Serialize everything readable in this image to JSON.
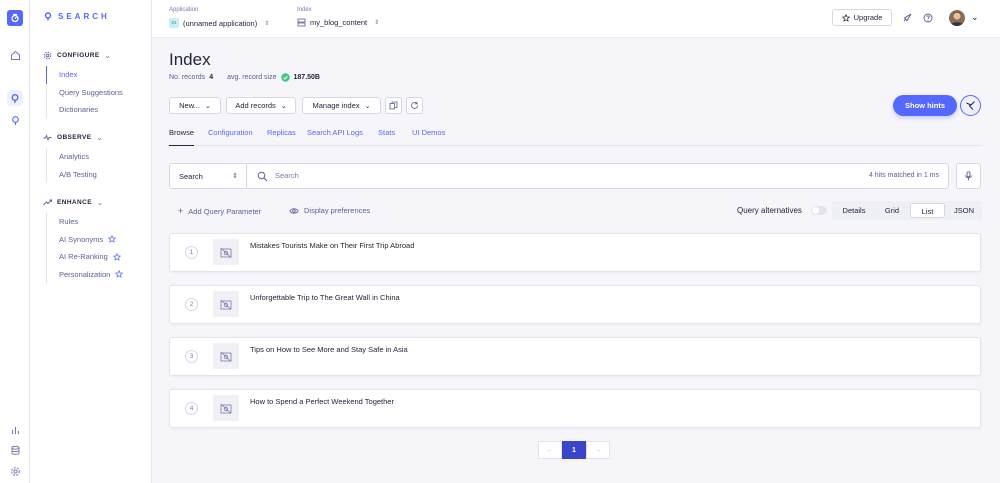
{
  "brand": {
    "name": "SEARCH"
  },
  "sidebar": {
    "sections": [
      {
        "title": "CONFIGURE",
        "items": [
          {
            "label": "Index",
            "active": true
          },
          {
            "label": "Query Suggestions"
          },
          {
            "label": "Dictionaries"
          }
        ]
      },
      {
        "title": "OBSERVE",
        "items": [
          {
            "label": "Analytics"
          },
          {
            "label": "A/B Testing"
          }
        ]
      },
      {
        "title": "ENHANCE",
        "items": [
          {
            "label": "Rules"
          },
          {
            "label": "AI Synonyms"
          },
          {
            "label": "AI Re-Ranking"
          },
          {
            "label": "Personalization"
          }
        ]
      }
    ]
  },
  "topbar": {
    "application_label": "Application",
    "application_value": "(unnamed application)",
    "application_badge": "01",
    "index_label": "Index",
    "index_value": "my_blog_content",
    "upgrade_label": "Upgrade"
  },
  "page": {
    "title": "Index",
    "records_label": "No. records",
    "records_value": "4",
    "avg_size_label": "avg. record size",
    "avg_size_value": "187.50B"
  },
  "toolbar": {
    "new_label": "New...",
    "add_records_label": "Add records",
    "manage_index_label": "Manage index",
    "show_hints_label": "Show hints"
  },
  "tabs": [
    "Browse",
    "Configuration",
    "Replicas",
    "Search API Logs",
    "Stats",
    "UI Demos"
  ],
  "search": {
    "select_value": "Search",
    "placeholder": "Search",
    "hits_text": "4 hits matched in 1 ms"
  },
  "options": {
    "add_query_param": "Add Query Parameter",
    "display_prefs": "Display preferences",
    "query_alternatives": "Query alternatives",
    "views": [
      "Details",
      "Grid",
      "List",
      "JSON"
    ],
    "active_view": "List"
  },
  "results": [
    {
      "num": "1",
      "title": "Mistakes Tourists Make on Their First Trip Abroad"
    },
    {
      "num": "2",
      "title": "Unforgettable Trip to The Great Wall in China"
    },
    {
      "num": "3",
      "title": "Tips on How to See More and Stay Safe in Asia"
    },
    {
      "num": "4",
      "title": "How to Spend a Perfect Weekend Together"
    }
  ],
  "pagination": {
    "prev": "←",
    "current": "1",
    "next": "→"
  },
  "colors": {
    "accent": "#5468ff",
    "text": "#23263b",
    "muted": "#5a5e9a",
    "current_page": "#3a46c9"
  }
}
